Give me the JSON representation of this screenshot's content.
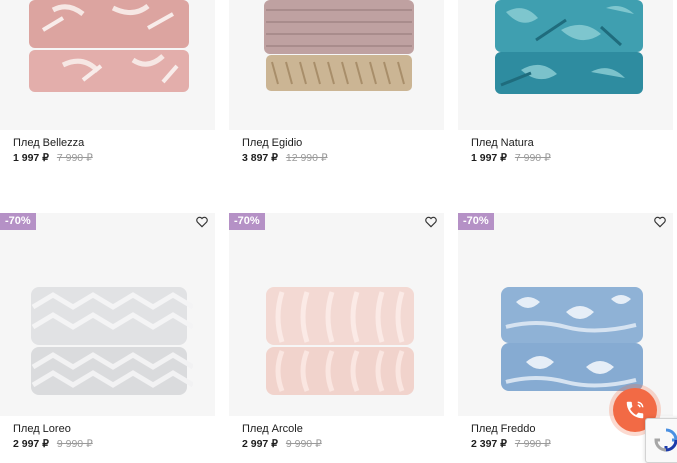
{
  "products": [
    {
      "name": "Плед Bellezza",
      "price": "1 997 ₽",
      "old_price": "7 990 ₽",
      "badge": ""
    },
    {
      "name": "Плед Egidio",
      "price": "3 897 ₽",
      "old_price": "12 990 ₽",
      "badge": ""
    },
    {
      "name": "Плед Natura",
      "price": "1 997 ₽",
      "old_price": "7 990 ₽",
      "badge": ""
    },
    {
      "name": "Плед Loreo",
      "price": "2 997 ₽",
      "old_price": "9 990 ₽",
      "badge": "-70%"
    },
    {
      "name": "Плед Arcole",
      "price": "2 997 ₽",
      "old_price": "9 990 ₽",
      "badge": "-70%"
    },
    {
      "name": "Плед Freddo",
      "price": "2 397 ₽",
      "old_price": "7 990 ₽",
      "badge": "-70%"
    }
  ],
  "icons": {
    "wishlist": "heart-icon",
    "call": "phone-icon",
    "captcha": "recaptcha-icon"
  },
  "colors": {
    "badge": "#b591c6",
    "call_button": "#f26a45",
    "old_price": "#9a9a9a"
  }
}
